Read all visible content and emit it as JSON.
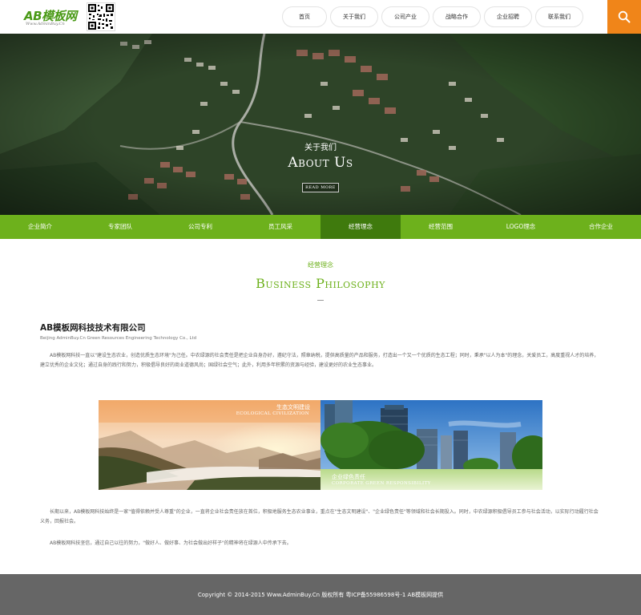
{
  "header": {
    "logo_text": "AB模板网",
    "logo_sub": "Www.AdminBuy.Cn",
    "nav": [
      "首页",
      "关于我们",
      "公司产业",
      "战略合作",
      "企业招聘",
      "联系我们"
    ]
  },
  "banner": {
    "subtitle": "关于我们",
    "title": "About Us",
    "more": "READ MORE"
  },
  "subnav": {
    "items": [
      "企业简介",
      "专家团队",
      "公司专利",
      "员工风采",
      "经营理念",
      "经营范围",
      "LOGO理念",
      "合作企业"
    ],
    "active_index": 4
  },
  "section": {
    "title_cn": "经营理念",
    "title_en": "Business Philosophy"
  },
  "content": {
    "company": "AB模板网科技技术有限公司",
    "company_en": "Beijing AdminBuy.Cn Green Resources Engineering Technology Co., Ltd",
    "para1": "AB模板网科技一直以\"建设生态农业，创造优质生态环境\"为己任。中农绿源的社会责任是把企业自身办好，遵纪守法，照章纳税，提供高质量的产品和服务，打造出一个又一个优质的生态工程；同时，秉承\"以人为本\"的理念，关爱员工，高度重视人才的培养，建立优秀的企业文化；通过自身的践行和努力，积极倡导良好的商业道德风尚；国绿社会空气；此外，利用多年积累的资源与经验，建设更好的农业生态事业。",
    "caption1_cn": "生态文明建设",
    "caption1_en": "ECOLOGICAL CIVILIZATION",
    "caption2_cn": "企业绿色责任",
    "caption2_en": "CORPORATE GREEN RESPONSIBILITY",
    "para2": "长期以来，AB模板网科技始终是一家\"值得依赖并受人尊重\"的企业，一直将企业社会责任放在首位，积极地服务生态农业事业，重点在\"生态文明建设\"、\"企业绿色责任\"等领域和社会长期投入。同时，中农绿源积极倡导员工参与社会活动，以实际行动履行社会义务，回报社会。",
    "para3": "AB模板网科技坚信，通过自己以往的努力，\"做好人、做好事、为社会做出好样子\"的精神将在绿源人中传承下去。"
  },
  "footer": {
    "text": "Copyright © 2014-2015 Www.AdminBuy.Cn 版权所有 粤ICP备55986598号-1     AB模板网提供"
  },
  "colors": {
    "brand_green": "#6db11c",
    "active_green": "#3f7a0d",
    "search_orange": "#f08519",
    "footer_gray": "#666666"
  }
}
